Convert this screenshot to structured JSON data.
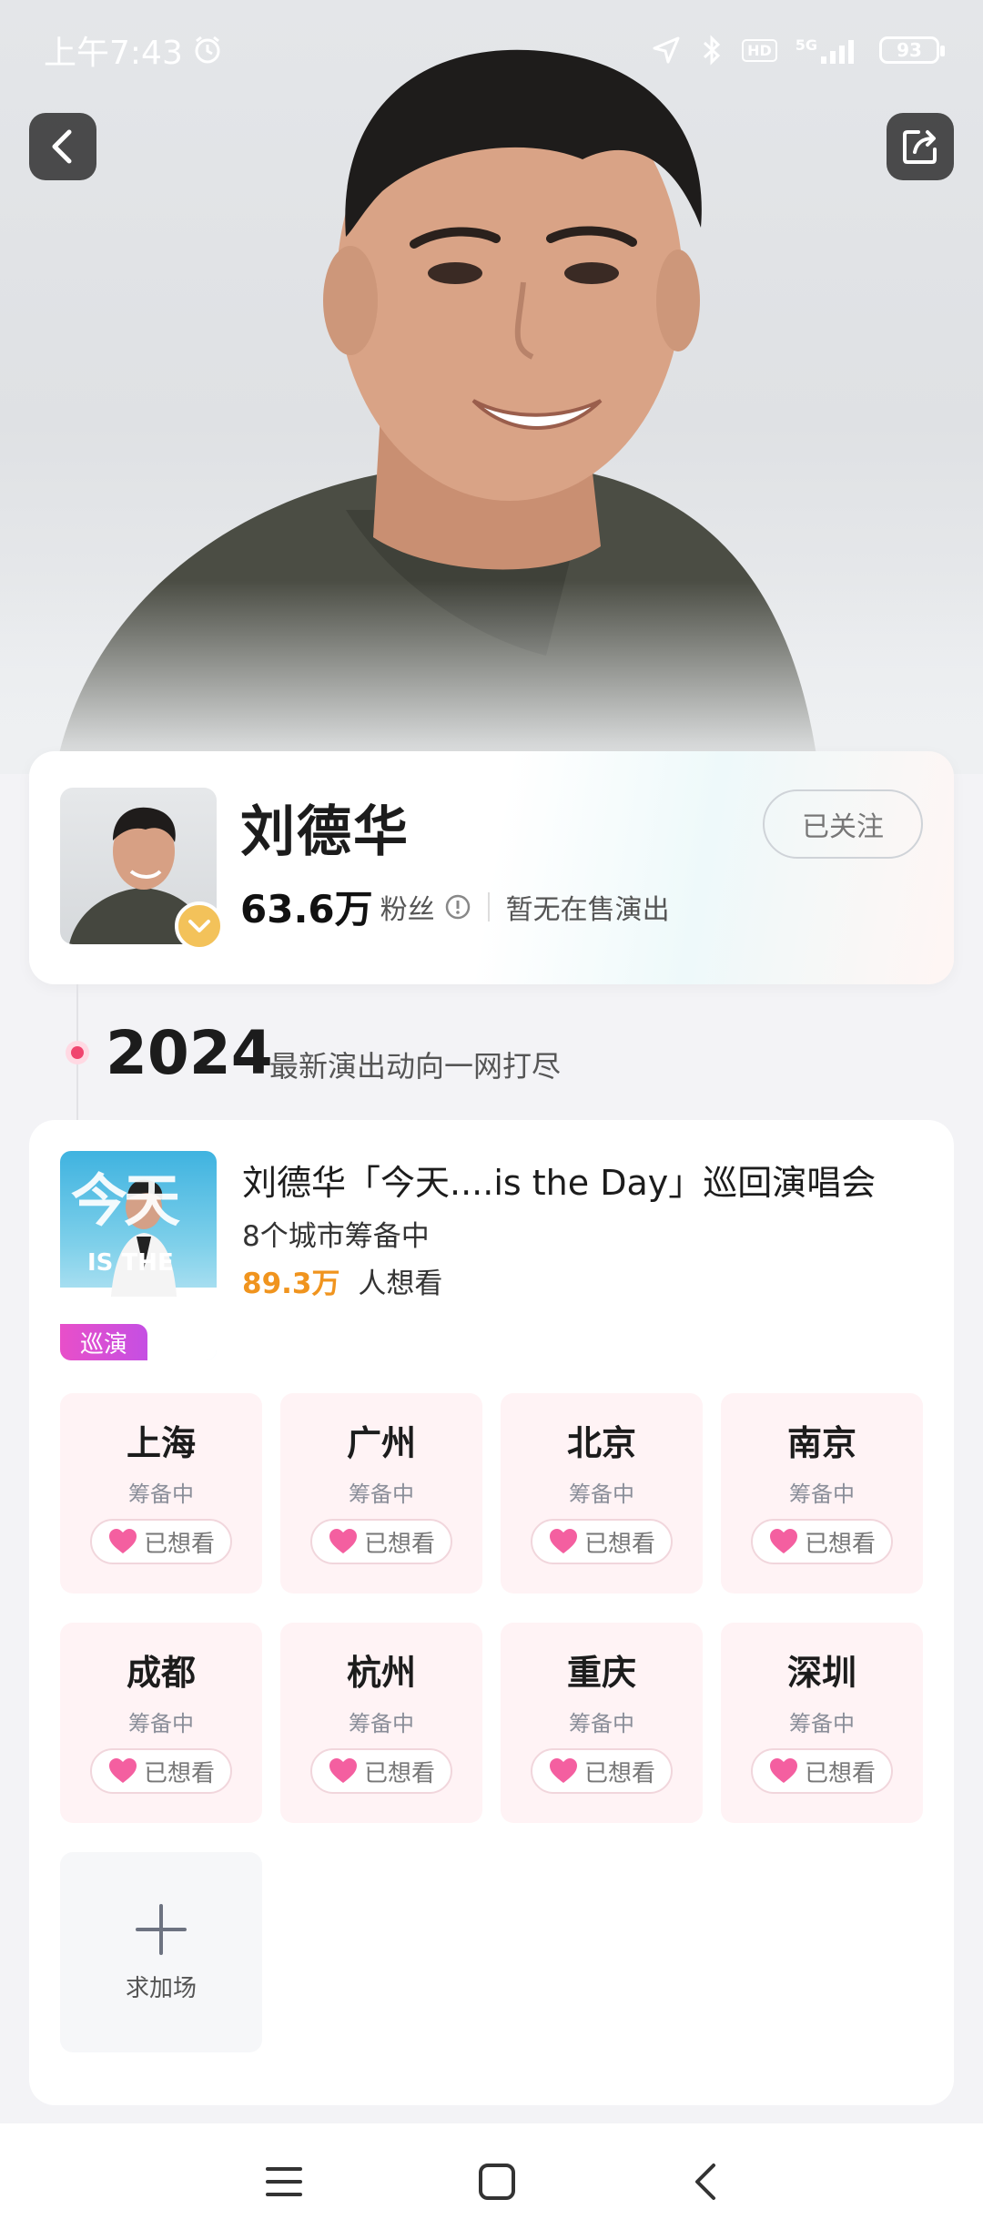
{
  "status_bar": {
    "time": "上午7:43",
    "network": "5G",
    "hd": "HD",
    "battery": "93"
  },
  "profile": {
    "name": "刘德华",
    "fans_count": "63.6万",
    "fans_label": "粉丝",
    "no_show_text": "暂无在售演出",
    "follow_label": "已关注"
  },
  "timeline": {
    "year": "2024",
    "subtitle": "最新演出动向一网打尽"
  },
  "event": {
    "title": "刘德华「今天....is the Day」巡回演唱会",
    "cities_text": "8个城市筹备中",
    "want_count": "89.3万",
    "want_label": "人想看",
    "tag": "巡演",
    "poster_big": "今天",
    "poster_sub": "IS THE"
  },
  "cities": [
    {
      "name": "上海",
      "status": "筹备中",
      "wanted": "已想看"
    },
    {
      "name": "广州",
      "status": "筹备中",
      "wanted": "已想看"
    },
    {
      "name": "北京",
      "status": "筹备中",
      "wanted": "已想看"
    },
    {
      "name": "南京",
      "status": "筹备中",
      "wanted": "已想看"
    },
    {
      "name": "成都",
      "status": "筹备中",
      "wanted": "已想看"
    },
    {
      "name": "杭州",
      "status": "筹备中",
      "wanted": "已想看"
    },
    {
      "name": "重庆",
      "status": "筹备中",
      "wanted": "已想看"
    },
    {
      "name": "深圳",
      "status": "筹备中",
      "wanted": "已想看"
    }
  ],
  "add_show_label": "求加场",
  "colors": {
    "accent_pink": "#f0456f",
    "want_orange": "#f0941e",
    "city_bg": "#fff3f5",
    "tour_tag": "#d94fd6"
  }
}
